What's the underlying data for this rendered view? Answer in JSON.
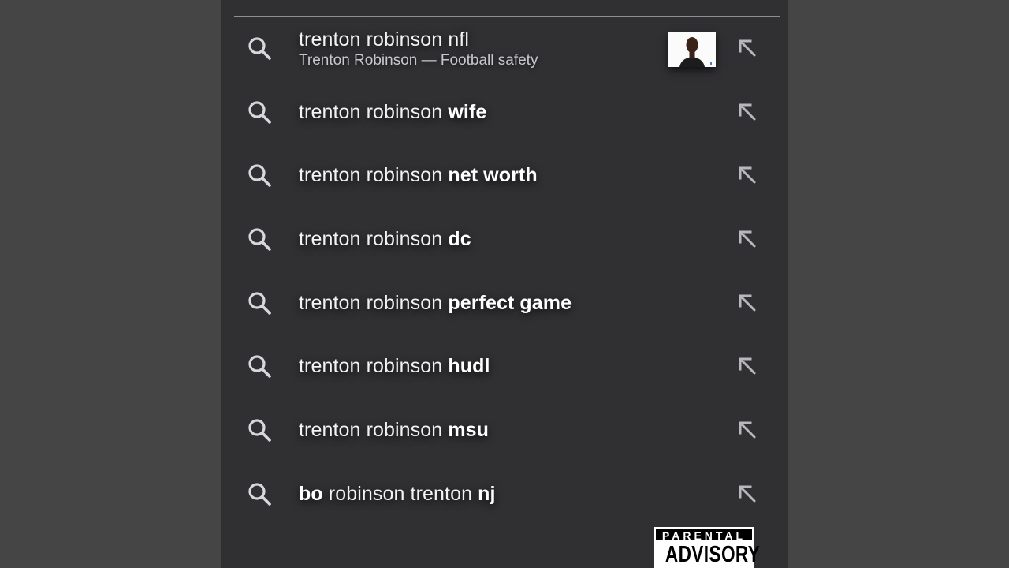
{
  "suggestions": [
    {
      "parts": [
        {
          "text": "trenton robinson nfl",
          "bold": false
        }
      ],
      "subtitle": "Trenton Robinson — Football safety",
      "has_thumbnail": true
    },
    {
      "parts": [
        {
          "text": "trenton robinson ",
          "bold": false
        },
        {
          "text": "wife",
          "bold": true
        }
      ]
    },
    {
      "parts": [
        {
          "text": "trenton robinson ",
          "bold": false
        },
        {
          "text": "net worth",
          "bold": true
        }
      ]
    },
    {
      "parts": [
        {
          "text": "trenton robinson ",
          "bold": false
        },
        {
          "text": "dc",
          "bold": true
        }
      ]
    },
    {
      "parts": [
        {
          "text": "trenton robinson ",
          "bold": false
        },
        {
          "text": "perfect game",
          "bold": true
        }
      ]
    },
    {
      "parts": [
        {
          "text": "trenton robinson ",
          "bold": false
        },
        {
          "text": "hudl",
          "bold": true
        }
      ]
    },
    {
      "parts": [
        {
          "text": "trenton robinson ",
          "bold": false
        },
        {
          "text": "msu",
          "bold": true
        }
      ]
    },
    {
      "parts": [
        {
          "text": "bo",
          "bold": true
        },
        {
          "text": " robinson trenton ",
          "bold": false
        },
        {
          "text": "nj",
          "bold": true
        }
      ]
    }
  ],
  "advisory": {
    "top": "PARENTAL",
    "bottom": "ADVISORY"
  },
  "icons": {
    "search": "search-icon",
    "fill_query": "arrow-up-left-icon"
  },
  "colors": {
    "panel": "#303033",
    "side": "#454545",
    "text": "#f2f2f2",
    "subtext": "#c8c8cc",
    "icon": "#d8d8dc"
  }
}
